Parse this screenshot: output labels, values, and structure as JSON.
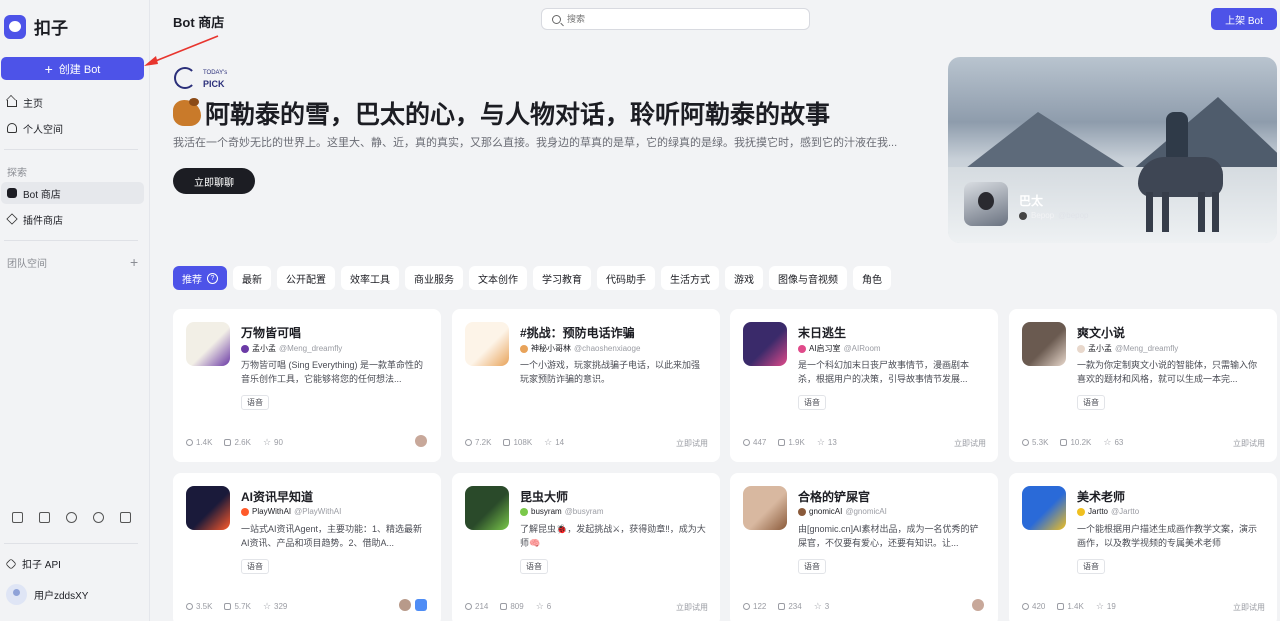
{
  "app": {
    "name": "扣子",
    "brand_color": "#4d53e8"
  },
  "sidebar": {
    "create_button": "创建 Bot",
    "nav_main": [
      {
        "label": "主页",
        "icon": "home-icon"
      },
      {
        "label": "个人空间",
        "icon": "user-icon"
      }
    ],
    "explore_label": "探索",
    "nav_explore": [
      {
        "label": "Bot 商店",
        "icon": "bot-icon",
        "active": true
      },
      {
        "label": "插件商店",
        "icon": "plugin-icon"
      }
    ],
    "team_label": "团队空间",
    "api_label": "扣子 API",
    "user_name": "用户zddsXY"
  },
  "header": {
    "title": "Bot 商店",
    "search_placeholder": "搜索",
    "publish_button": "上架 Bot"
  },
  "hero": {
    "badge_small": "TODAY's",
    "badge_big": "PICK",
    "title": "阿勒泰的雪，巴太的心，与人物对话，聆听阿勒泰的故事",
    "description": "我活在一个奇妙无比的世界上。这里大、静、近，真的真实，又那么直接。我身边的草真的是草，它的绿真的是绿。我抚摸它时，感到它的汁液在我...",
    "cta": "立即聊聊",
    "featured": {
      "name": "巴太",
      "author": "Bepop",
      "handle": "@bepop"
    }
  },
  "tabs": [
    {
      "label": "推荐",
      "active": true
    },
    {
      "label": "最新"
    },
    {
      "label": "公开配置"
    },
    {
      "label": "效率工具"
    },
    {
      "label": "商业服务"
    },
    {
      "label": "文本创作"
    },
    {
      "label": "学习教育"
    },
    {
      "label": "代码助手"
    },
    {
      "label": "生活方式"
    },
    {
      "label": "游戏"
    },
    {
      "label": "图像与音视频"
    },
    {
      "label": "角色"
    }
  ],
  "cards": [
    {
      "title": "万物皆可唱",
      "author": "孟小孟",
      "handle": "@Meng_dreamfly",
      "desc": "万物皆可唱 (Sing Everything) 是一款革命性的音乐创作工具，它能够将您的任何想法...",
      "tag": "语音",
      "users": "1.4K",
      "chats": "2.6K",
      "stars": "90",
      "try": "",
      "icon_color": "#f2efe6",
      "accent": "#6b3aa6"
    },
    {
      "title": "#挑战：预防电话诈骗",
      "author": "神秘小哥林",
      "handle": "@chaoshenxiaoge",
      "desc": "一个小游戏，玩家挑战骗子电话，以此来加强玩家预防诈骗的意识。",
      "tag": "",
      "users": "7.2K",
      "chats": "108K",
      "stars": "14",
      "try": "立即试用",
      "icon_color": "#fdf4e8",
      "accent": "#e8a35a"
    },
    {
      "title": "末日逃生",
      "author": "AI启习室",
      "handle": "@AIRoom",
      "desc": "是一个科幻加末日丧尸故事情节，漫画剧本杀，根据用户的决策，引导故事情节发展...",
      "tag": "语音",
      "users": "447",
      "chats": "1.9K",
      "stars": "13",
      "try": "立即试用",
      "icon_color": "#3a2a6a",
      "accent": "#e04a8a"
    },
    {
      "title": "爽文小说",
      "author": "孟小孟",
      "handle": "@Meng_dreamfly",
      "desc": "一款为你定制爽文小说的智能体，只需输入你喜欢的题材和风格，就可以生成一本完...",
      "tag": "语音",
      "users": "5.3K",
      "chats": "10.2K",
      "stars": "63",
      "try": "立即试用",
      "icon_color": "#6a5a50",
      "accent": "#e8d8cc"
    },
    {
      "title": "AI资讯早知道",
      "author": "PlayWithAI",
      "handle": "@PlayWithAI",
      "desc": "一站式AI资讯Agent，主要功能：1、精选最新AI资讯、产品和项目趋势。2、借助A...",
      "tag": "语音",
      "users": "3.5K",
      "chats": "5.7K",
      "stars": "329",
      "try": "",
      "icon_color": "#1a1a3a",
      "accent": "#ff5a2a"
    },
    {
      "title": "昆虫大师",
      "author": "busyram",
      "handle": "@busyram",
      "desc": "了解昆虫🐞，发起挑战⚔，获得勋章‼，成为大师🧠",
      "tag": "语音",
      "users": "214",
      "chats": "809",
      "stars": "6",
      "try": "立即试用",
      "icon_color": "#2a4a2a",
      "accent": "#7ac84a"
    },
    {
      "title": "合格的铲屎官",
      "author": "gnomicAI",
      "handle": "@gnomicAI",
      "desc": "由[gnomic.cn]AI素材出品，成为一名优秀的铲屎官，不仅要有爱心，还要有知识。让...",
      "tag": "语音",
      "users": "122",
      "chats": "234",
      "stars": "3",
      "try": "",
      "icon_color": "#d8b8a0",
      "accent": "#8a5a3a"
    },
    {
      "title": "美术老师",
      "author": "Jartto",
      "handle": "@Jartto",
      "desc": "一个能根据用户描述生成画作教学文案，演示画作，以及教学视频的专属美术老师",
      "tag": "语音",
      "users": "420",
      "chats": "1.4K",
      "stars": "19",
      "try": "立即试用",
      "icon_color": "#2a6ad8",
      "accent": "#f0c020"
    }
  ]
}
